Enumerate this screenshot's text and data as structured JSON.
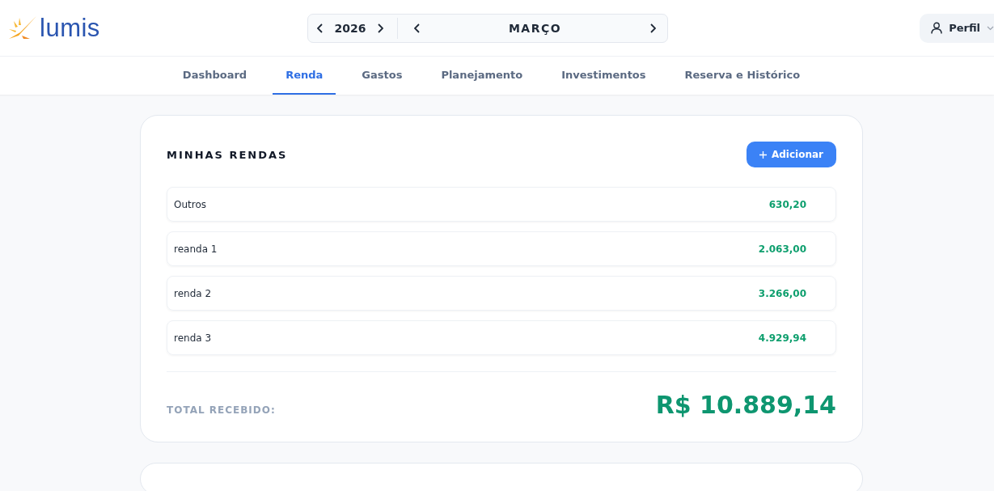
{
  "brand": {
    "name": "lumis"
  },
  "period": {
    "year": "2026",
    "month": "MARÇO"
  },
  "profile": {
    "label": "Perfil"
  },
  "tabs": [
    {
      "label": "Dashboard",
      "selected": false
    },
    {
      "label": "Renda",
      "selected": true
    },
    {
      "label": "Gastos",
      "selected": false
    },
    {
      "label": "Planejamento",
      "selected": false
    },
    {
      "label": "Investimentos",
      "selected": false
    },
    {
      "label": "Reserva e Histórico",
      "selected": false
    }
  ],
  "incomes": {
    "title": "MINHAS RENDAS",
    "add_button": "Adicionar",
    "rows": [
      {
        "name": "Outros",
        "amount": "630,20"
      },
      {
        "name": "reanda 1",
        "amount": "2.063,00"
      },
      {
        "name": "renda 2",
        "amount": "3.266,00"
      },
      {
        "name": "renda 3",
        "amount": "4.929,94"
      }
    ],
    "total_label": "TOTAL RECEBIDO:",
    "total": "R$ 10.889,14"
  }
}
